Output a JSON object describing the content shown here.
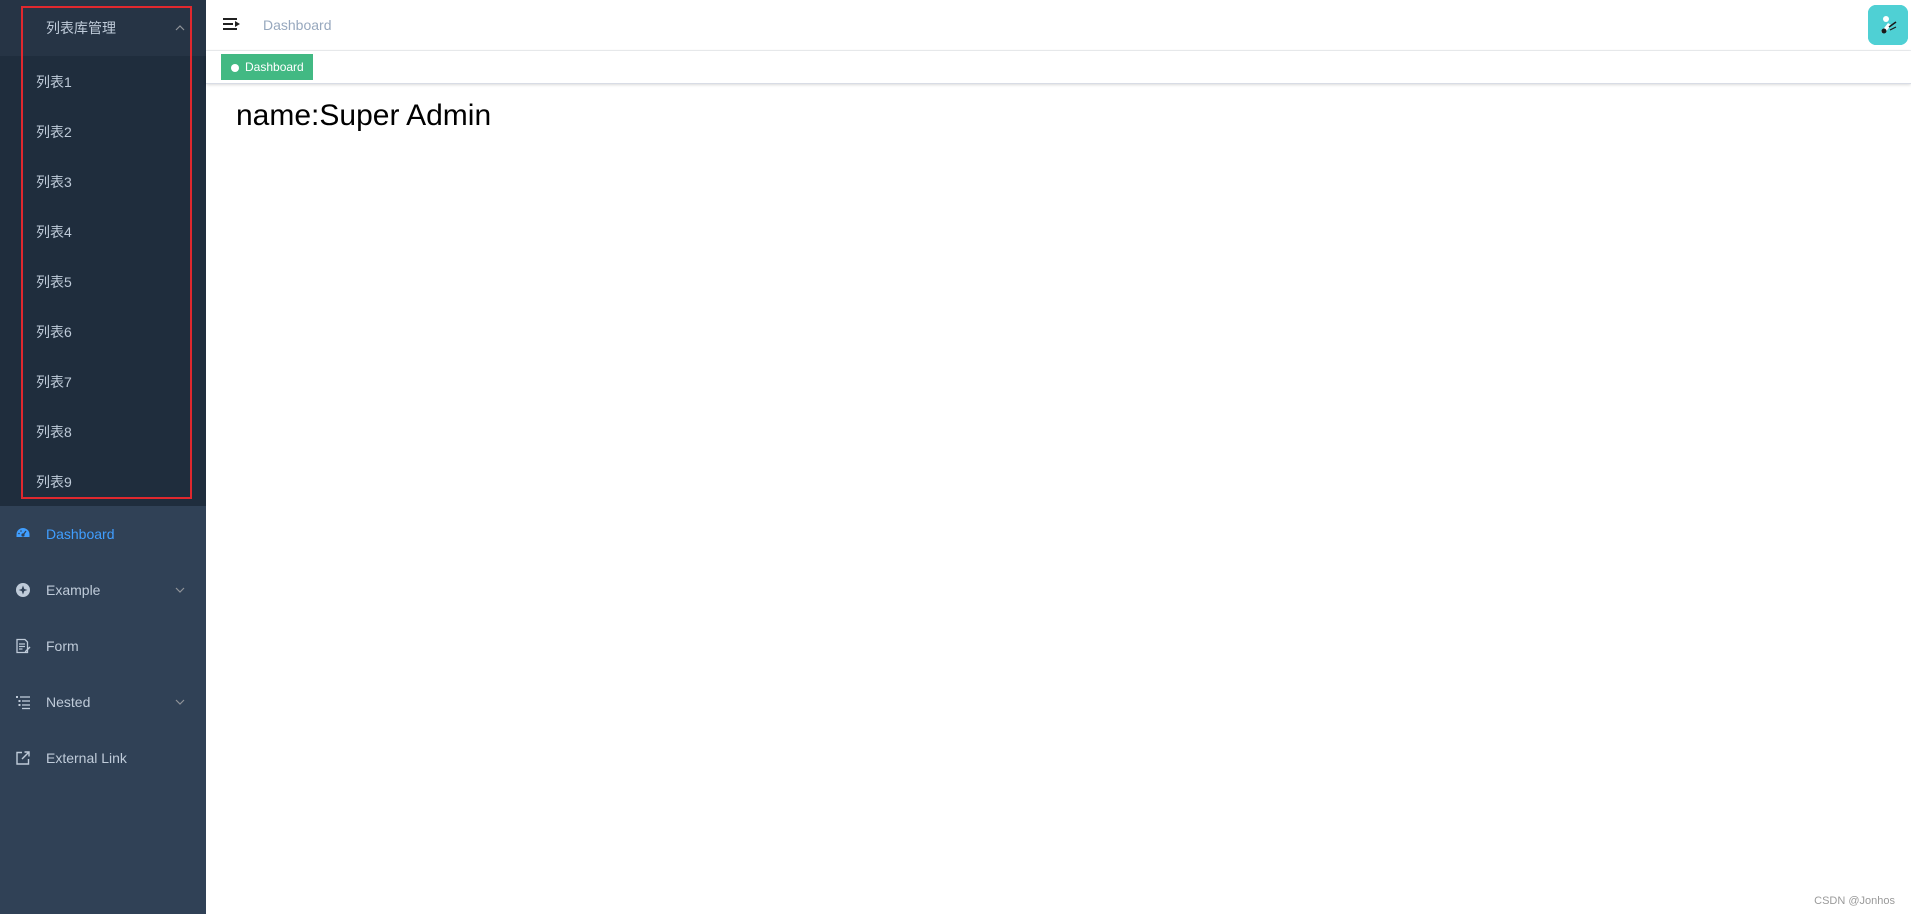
{
  "sidebar": {
    "submenu": {
      "title": "列表库管理",
      "expanded": true,
      "items": [
        "列表1",
        "列表2",
        "列表3",
        "列表4",
        "列表5",
        "列表6",
        "列表7",
        "列表8",
        "列表9"
      ]
    },
    "items": [
      {
        "label": "Dashboard",
        "icon": "dashboard-icon",
        "active": true
      },
      {
        "label": "Example",
        "icon": "example-icon",
        "has_children": true
      },
      {
        "label": "Form",
        "icon": "form-icon"
      },
      {
        "label": "Nested",
        "icon": "nested-icon",
        "has_children": true
      },
      {
        "label": "External Link",
        "icon": "link-icon"
      }
    ]
  },
  "navbar": {
    "breadcrumb": "Dashboard",
    "hamburger_icon": "hamburger-icon",
    "avatar_icon": "avatar-image"
  },
  "tags_view": {
    "tags": [
      {
        "label": "Dashboard",
        "active": true
      }
    ]
  },
  "main": {
    "dashboard_text": "name:Super Admin"
  },
  "watermark": "CSDN @Jonhos",
  "colors": {
    "sidebar_bg": "#304156",
    "submenu_bg": "#1f2d3d",
    "submenu_title_bg": "#263445",
    "menu_text": "#bfcbd9",
    "active_text": "#409eff",
    "tag_bg": "#42b983",
    "highlight_border": "#e0282e",
    "avatar_bg": "#4fd0d4"
  }
}
